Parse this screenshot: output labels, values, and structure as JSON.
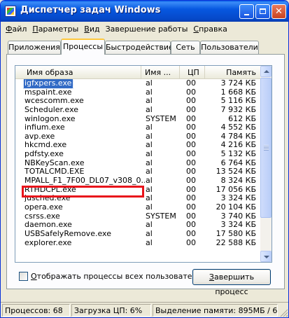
{
  "window": {
    "title": "Диспетчер задач Windows",
    "title_bar_color": "#0758e0"
  },
  "menu": [
    {
      "accel": "Ф",
      "rest": "айл"
    },
    {
      "accel": "П",
      "rest": "араметры"
    },
    {
      "accel": "В",
      "rest": "ид"
    },
    {
      "accel": "",
      "rest": "Завершение работы"
    },
    {
      "accel": "С",
      "rest": "правка"
    }
  ],
  "tabs": [
    {
      "label": "Приложения",
      "active": false
    },
    {
      "label": "Процессы",
      "active": true
    },
    {
      "label": "Быстродействие",
      "active": false
    },
    {
      "label": "Сеть",
      "active": false
    },
    {
      "label": "Пользователи",
      "active": false
    }
  ],
  "columns": {
    "image_name": "Имя образа",
    "user_name": "Имя ...",
    "cpu": "ЦП",
    "memory": "Память"
  },
  "processes": [
    {
      "name": "igfxpers.exe",
      "user": "al",
      "cpu": "00",
      "mem": "3 724 КБ",
      "selected": true
    },
    {
      "name": "mspaint.exe",
      "user": "al",
      "cpu": "00",
      "mem": "1 668 КБ"
    },
    {
      "name": "wcescomm.exe",
      "user": "al",
      "cpu": "00",
      "mem": "5 116 КБ"
    },
    {
      "name": "Scheduler.exe",
      "user": "al",
      "cpu": "00",
      "mem": "7 932 КБ"
    },
    {
      "name": "winlogon.exe",
      "user": "SYSTEM",
      "cpu": "00",
      "mem": "612 КБ"
    },
    {
      "name": "infium.exe",
      "user": "al",
      "cpu": "00",
      "mem": "4 552 КБ"
    },
    {
      "name": "avp.exe",
      "user": "al",
      "cpu": "00",
      "mem": "4 784 КБ"
    },
    {
      "name": "hkcmd.exe",
      "user": "al",
      "cpu": "00",
      "mem": "4 216 КБ"
    },
    {
      "name": "pdfsty.exe",
      "user": "al",
      "cpu": "00",
      "mem": "5 132 КБ"
    },
    {
      "name": "NBKeyScan.exe",
      "user": "al",
      "cpu": "00",
      "mem": "6 764 КБ"
    },
    {
      "name": "TOTALCMD.EXE",
      "user": "al",
      "cpu": "00",
      "mem": "13 524 КБ"
    },
    {
      "name": "MPALL_F1_7F00_DL07_v308_0...",
      "user": "al",
      "cpu": "00",
      "mem": "8 324 КБ"
    },
    {
      "name": "RTHDCPL.exe",
      "user": "al",
      "cpu": "00",
      "mem": "17 056 КБ"
    },
    {
      "name": "jusched.exe",
      "user": "al",
      "cpu": "00",
      "mem": "3 324 КБ"
    },
    {
      "name": "opera.exe",
      "user": "al",
      "cpu": "00",
      "mem": "20 104 КБ"
    },
    {
      "name": "csrss.exe",
      "user": "SYSTEM",
      "cpu": "00",
      "mem": "3 740 КБ"
    },
    {
      "name": "daemon.exe",
      "user": "al",
      "cpu": "00",
      "mem": "3 324 КБ"
    },
    {
      "name": "USBSafelyRemove.exe",
      "user": "al",
      "cpu": "00",
      "mem": "17 580 КБ"
    },
    {
      "name": "explorer.exe",
      "user": "al",
      "cpu": "00",
      "mem": "22 588 КБ"
    }
  ],
  "show_all_users": {
    "accel": "О",
    "rest": "тображать процессы всех пользователей",
    "checked": false
  },
  "end_process_button": {
    "accel": "З",
    "rest": "авершить процесс"
  },
  "status": {
    "processes": "Процессов: 68",
    "cpu_load": "Загрузка ЦП: 6%",
    "memory": "Выделение памяти: 895МБ / 6"
  },
  "highlight_color": "#e8141b"
}
